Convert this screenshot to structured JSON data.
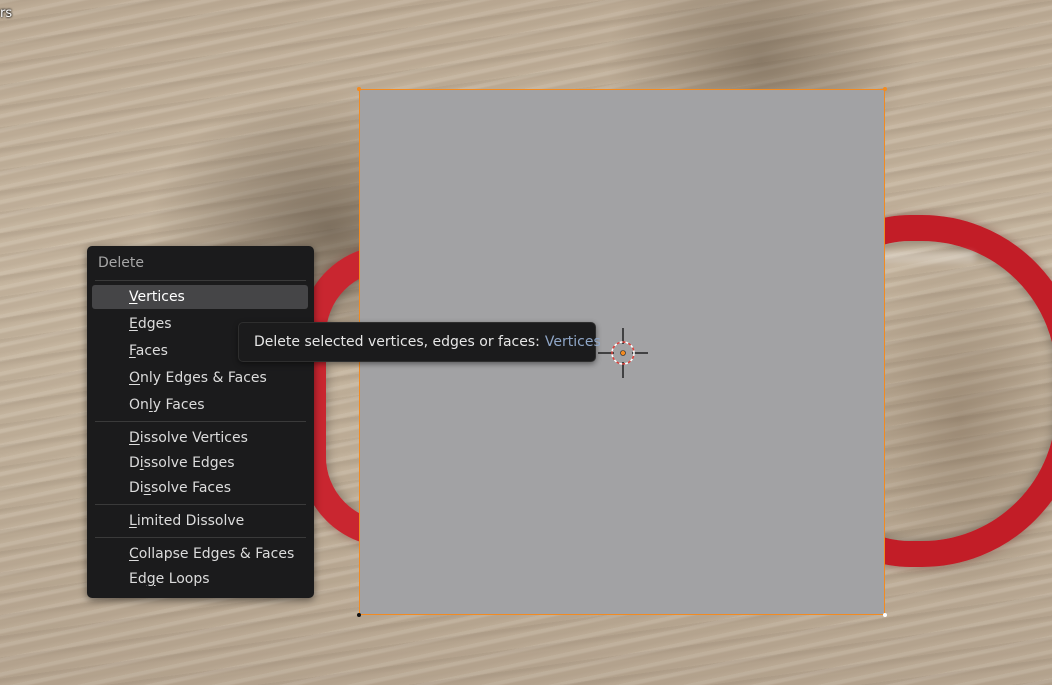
{
  "viewport": {
    "corner_label": "rs"
  },
  "menu": {
    "title": "Delete",
    "groups": [
      [
        {
          "pre": "",
          "key": "V",
          "post": "ertices",
          "active": true
        },
        {
          "pre": "",
          "key": "E",
          "post": "dges"
        },
        {
          "pre": "",
          "key": "F",
          "post": "aces"
        },
        {
          "pre": "",
          "key": "O",
          "post": "nly Edges & Faces"
        },
        {
          "pre": "On",
          "key": "l",
          "post": "y Faces"
        }
      ],
      [
        {
          "pre": "",
          "key": "D",
          "post": "issolve Vertices"
        },
        {
          "pre": "D",
          "key": "i",
          "post": "ssolve Edges"
        },
        {
          "pre": "Di",
          "key": "s",
          "post": "solve Faces"
        }
      ],
      [
        {
          "pre": "",
          "key": "L",
          "post": "imited Dissolve"
        }
      ],
      [
        {
          "pre": "",
          "key": "C",
          "post": "ollapse Edges & Faces"
        },
        {
          "pre": "Ed",
          "key": "g",
          "post": "e Loops"
        }
      ]
    ]
  },
  "tooltip": {
    "text": "Delete selected vertices, edges or faces:",
    "highlight": "Vertices",
    "highlight_color": "#8fa6c7"
  },
  "colors": {
    "selection_orange": "#f28b21",
    "menu_bg": "#1b1b1c",
    "menu_active": "#454547",
    "plane_gray": "#a2a2a4"
  }
}
